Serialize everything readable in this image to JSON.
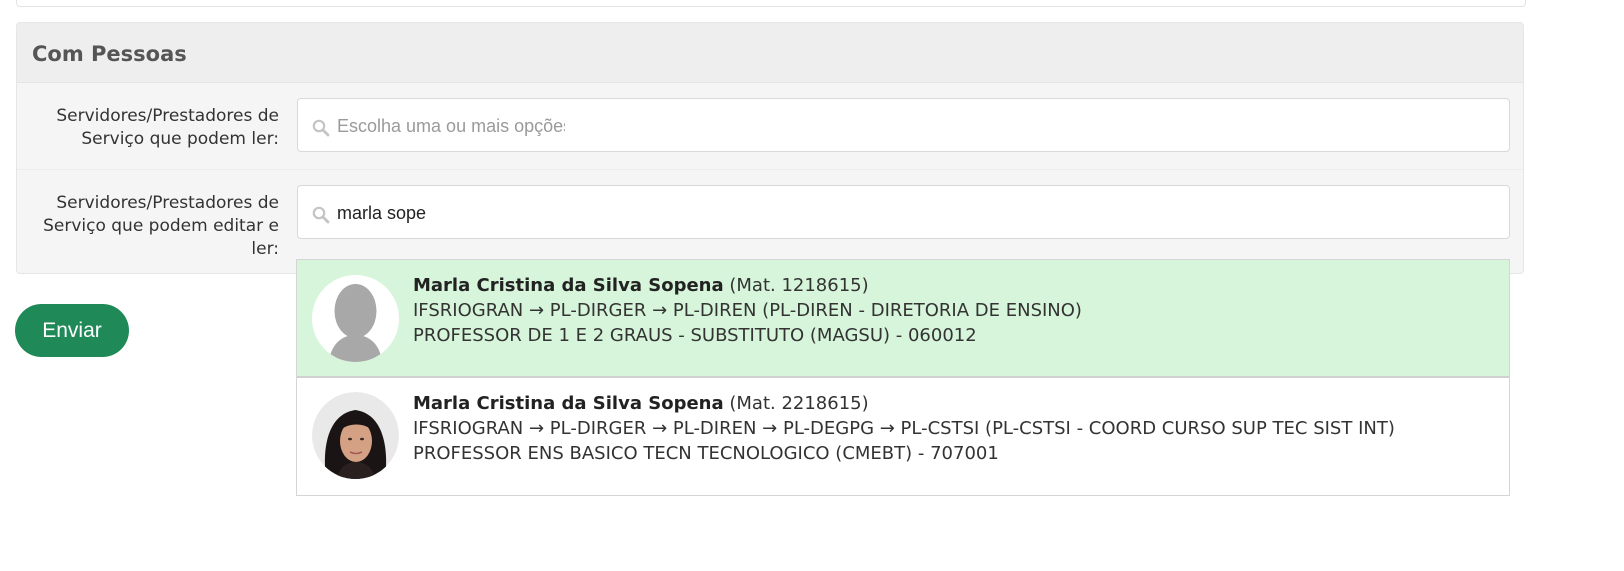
{
  "panel": {
    "title": "Com Pessoas"
  },
  "readers": {
    "label_line1": "Servidores/Prestadores de",
    "label_line2": "Serviço que podem ler:",
    "placeholder": "Escolha uma ou mais opções"
  },
  "editors": {
    "label_line1": "Servidores/Prestadores de",
    "label_line2": "Serviço que podem editar e",
    "label_line3": "ler:",
    "value": "marla sope"
  },
  "submit": {
    "label": "Enviar"
  },
  "colors": {
    "primary": "#1f8a57",
    "highlight": "#d6f5da"
  },
  "results": [
    {
      "name": "Marla Cristina da Silva Sopena",
      "registration": "(Mat. 1218615)",
      "unit_path": "IFSRIOGRAN → PL-DIRGER → PL-DIREN (PL-DIREN - DIRETORIA DE ENSINO)",
      "position": "PROFESSOR DE 1 E 2 GRAUS - SUBSTITUTO (MAGSU) - 060012",
      "avatar": "default-avatar-silhouette",
      "highlighted": true
    },
    {
      "name": "Marla Cristina da Silva Sopena",
      "registration": "(Mat. 2218615)",
      "unit_path": "IFSRIOGRAN → PL-DIRGER → PL-DIREN → PL-DEGPG → PL-CSTSI (PL-CSTSI - COORD CURSO SUP TEC SIST INT)",
      "position": "PROFESSOR ENS BASICO TECN TECNOLOGICO (CMEBT) - 707001",
      "avatar": "user-photo",
      "highlighted": false
    }
  ]
}
